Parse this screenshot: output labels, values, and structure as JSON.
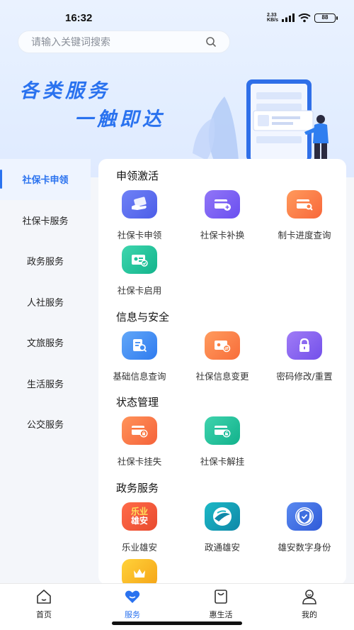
{
  "status": {
    "time": "16:32",
    "speed_top": "2.33",
    "speed_unit": "KB/s",
    "battery": "88"
  },
  "search": {
    "placeholder": "请输入关键词搜索"
  },
  "banner": {
    "line1": "各类服务",
    "line2": "一触即达"
  },
  "sidebar": {
    "items": [
      {
        "label": "社保卡申领",
        "active": true
      },
      {
        "label": "社保卡服务"
      },
      {
        "label": "政务服务"
      },
      {
        "label": "人社服务"
      },
      {
        "label": "文旅服务"
      },
      {
        "label": "生活服务"
      },
      {
        "label": "公交服务"
      }
    ]
  },
  "sections": [
    {
      "title": "申领激活",
      "items": [
        {
          "label": "社保卡申领",
          "icon": "hand-card-icon",
          "color": "#5b6cf0"
        },
        {
          "label": "社保卡补换",
          "icon": "card-add-icon",
          "color": "#7b61f4"
        },
        {
          "label": "制卡进度查询",
          "icon": "card-search-icon",
          "color": "#fb7c45"
        },
        {
          "label": "社保卡启用",
          "icon": "card-check-icon",
          "color": "#1fc29a"
        }
      ]
    },
    {
      "title": "信息与安全",
      "items": [
        {
          "label": "基础信息查询",
          "icon": "doc-search-icon",
          "color": "#3f8cf3"
        },
        {
          "label": "社保信息变更",
          "icon": "card-switch-icon",
          "color": "#fb7d3e"
        },
        {
          "label": "密码修改/重置",
          "icon": "lock-icon",
          "color": "#8b63ef"
        }
      ]
    },
    {
      "title": "状态管理",
      "items": [
        {
          "label": "社保卡挂失",
          "icon": "card-lock-icon",
          "color": "#fb733b"
        },
        {
          "label": "社保卡解挂",
          "icon": "card-unlock-icon",
          "color": "#1fbf9c"
        }
      ]
    },
    {
      "title": "政务服务",
      "items": [
        {
          "label": "乐业雄安",
          "icon": "leye-logo-icon",
          "color": "#f25a3e"
        },
        {
          "label": "政通雄安",
          "icon": "zhengtong-logo-icon",
          "color": "#1a9fb5"
        },
        {
          "label": "雄安数字身份",
          "icon": "digital-id-shield-icon",
          "color": "#3f6fe0"
        }
      ]
    }
  ],
  "logo_text": {
    "leye_top": "乐业",
    "leye_bottom": "雄安"
  },
  "bottom_nav": [
    {
      "label": "首页",
      "icon": "home-icon"
    },
    {
      "label": "服务",
      "icon": "heart-icon",
      "active": true
    },
    {
      "label": "惠生活",
      "icon": "shopping-bag-icon"
    },
    {
      "label": "我的",
      "icon": "user-icon"
    }
  ],
  "colors": {
    "accent": "#2a72ef"
  }
}
